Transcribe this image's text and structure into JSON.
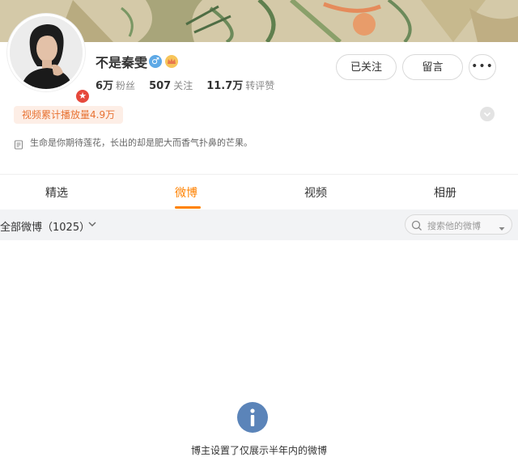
{
  "profile": {
    "name": "不是秦雯",
    "gender_icon": "male-icon",
    "gender_glyph": "♂",
    "badge_glyph": "★",
    "stats": [
      {
        "value": "6万",
        "label": "粉丝"
      },
      {
        "value": "507",
        "label": "关注"
      },
      {
        "value": "11.7万",
        "label": "转评赞"
      }
    ],
    "video_plays": "视频累计播放量4.9万",
    "bio": "生命是你期待莲花，长出的却是肥大而香气扑鼻的芒果。"
  },
  "actions": {
    "follow_label": "已关注",
    "message_label": "留言",
    "more_label": "•••"
  },
  "tabs": [
    {
      "label": "精选",
      "active": false
    },
    {
      "label": "微博",
      "active": true
    },
    {
      "label": "视频",
      "active": false
    },
    {
      "label": "相册",
      "active": false
    }
  ],
  "filter": {
    "label": "全部微博（1025）",
    "search_placeholder": "搜索他的微博"
  },
  "empty_state": {
    "glyph": "i",
    "text": "博主设置了仅展示半年内的微博"
  },
  "colors": {
    "accent": "#ff8200",
    "video_pill_text": "#e87232",
    "info_icon": "#5b84b9",
    "gender_icon": "#5ea9e6"
  }
}
